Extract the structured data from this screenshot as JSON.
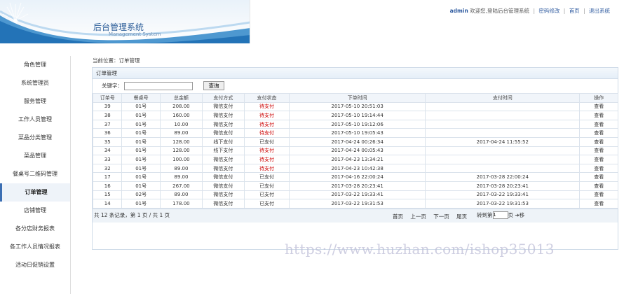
{
  "header": {
    "title": "后台管理系统",
    "subtitle": "Management System",
    "user": "admin",
    "welcome": "欢迎您,登陆后台管理系统",
    "change_password": "密码修改",
    "home": "首页",
    "logout": "退出系统"
  },
  "sidebar": {
    "items": [
      {
        "label": "角色管理"
      },
      {
        "label": "系统管理员"
      },
      {
        "label": "服务管理"
      },
      {
        "label": "工作人员管理"
      },
      {
        "label": "菜品分类管理"
      },
      {
        "label": "菜品管理"
      },
      {
        "label": "餐桌号二维码管理"
      },
      {
        "label": "订单管理",
        "active": true
      },
      {
        "label": "店铺管理"
      },
      {
        "label": "各分店财务报表"
      },
      {
        "label": "各工作人员情况报表"
      },
      {
        "label": "活动日促销设置"
      }
    ]
  },
  "breadcrumb": "当前位置：订单管理",
  "panel_title": "订单管理",
  "search": {
    "label": "关键字：",
    "value": "",
    "button": "查询"
  },
  "table": {
    "columns": [
      "订单号",
      "餐桌号",
      "总金额",
      "支付方式",
      "支付状态",
      "下单时间",
      "支付时间",
      "操作"
    ],
    "rows": [
      [
        "39",
        "01号",
        "208.00",
        "微信支付",
        "待支付",
        "2017-05-10 20:51:03",
        "",
        "查看"
      ],
      [
        "38",
        "01号",
        "160.00",
        "微信支付",
        "待支付",
        "2017-05-10 19:14:44",
        "",
        "查看"
      ],
      [
        "37",
        "01号",
        "10.00",
        "微信支付",
        "待支付",
        "2017-05-10 19:12:06",
        "",
        "查看"
      ],
      [
        "36",
        "01号",
        "89.00",
        "微信支付",
        "待支付",
        "2017-05-10 19:05:43",
        "",
        "查看"
      ],
      [
        "35",
        "01号",
        "128.00",
        "线下支付",
        "已支付",
        "2017-04-24 00:26:34",
        "2017-04-24 11:55:52",
        "查看"
      ],
      [
        "34",
        "01号",
        "128.00",
        "线下支付",
        "待支付",
        "2017-04-24 00:05:43",
        "",
        "查看"
      ],
      [
        "33",
        "01号",
        "100.00",
        "微信支付",
        "待支付",
        "2017-04-23 13:34:21",
        "",
        "查看"
      ],
      [
        "32",
        "01号",
        "89.00",
        "微信支付",
        "待支付",
        "2017-04-23 10:42:38",
        "",
        "查看"
      ],
      [
        "17",
        "01号",
        "89.00",
        "微信支付",
        "已支付",
        "2017-04-16 22:00:24",
        "2017-03-28 22:00:24",
        "查看"
      ],
      [
        "16",
        "01号",
        "267.00",
        "微信支付",
        "已支付",
        "2017-03-28 20:23:41",
        "2017-03-28 20:23:41",
        "查看"
      ],
      [
        "15",
        "02号",
        "89.00",
        "微信支付",
        "已支付",
        "2017-03-22 19:33:41",
        "2017-03-22 19:33:41",
        "查看"
      ],
      [
        "14",
        "01号",
        "178.00",
        "微信支付",
        "已支付",
        "2017-03-22 19:31:53",
        "2017-03-22 19:31:53",
        "查看"
      ]
    ]
  },
  "pager": {
    "info": "共 12 条记录，第 1 页 / 共 1 页",
    "first": "首页",
    "prev": "上一页",
    "next": "下一页",
    "last": "尾页",
    "goto_label": "转到第",
    "page_value": "1",
    "page_unit": "页",
    "goto_button": "➔移"
  },
  "watermark": "https://www.huzhan.com/ishop35013",
  "colors": {
    "accent": "#3c6fb3",
    "unpaid": "#cc0000",
    "panel_border": "#cfdbe8"
  }
}
